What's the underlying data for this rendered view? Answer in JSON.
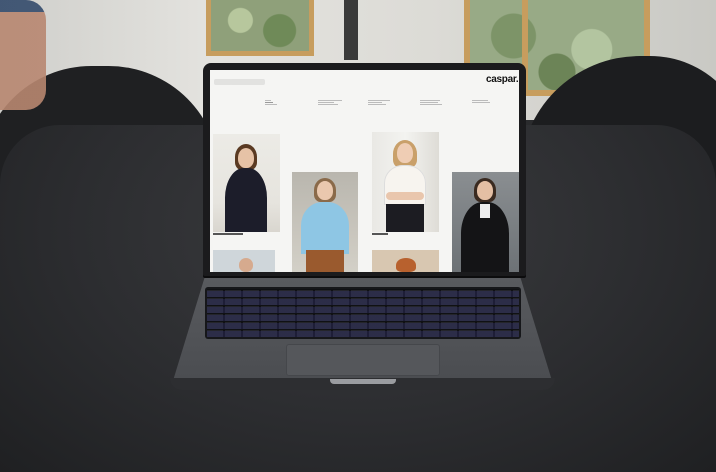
{
  "laptop_screen": {
    "logo": "caspar.",
    "nav_pills": [
      "",
      "",
      "",
      ""
    ]
  },
  "colors": {
    "table": "#2c2d30",
    "laptop_body": "#4a4c50",
    "screen_background": "#f5f5f3",
    "window_frame": "#c79d5e"
  }
}
